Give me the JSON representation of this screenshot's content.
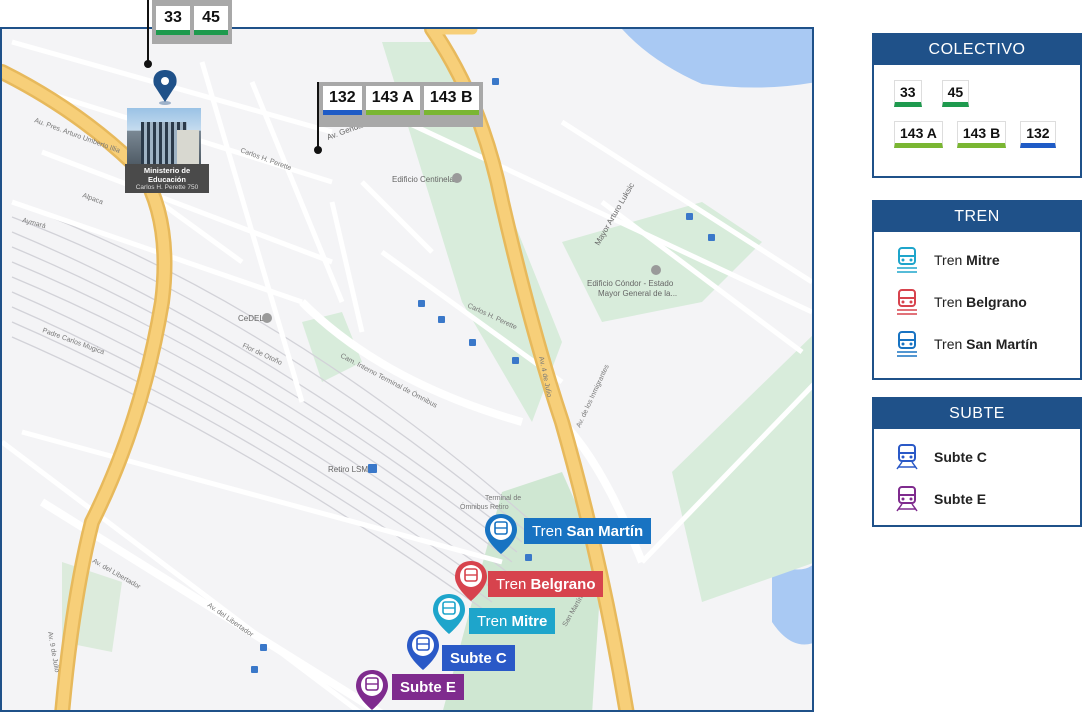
{
  "map": {
    "labels": {
      "gendarmeria": "Av. Gendarmería Nacional",
      "centinela": "Edificio Centinela",
      "condor_1": "Edificio Cóndor - Estado",
      "condor_2": "Mayor General de la...",
      "luksic": "Mayor Arturo Luksic",
      "perette_1": "Carlos H. Perette",
      "perette_2": "Carlos H. Perette",
      "alpaca": "Alpaca",
      "aymara": "Aymará",
      "cedel": "CeDEL",
      "flor_de_otono": "Flor de Otoño",
      "terminal_road": "Cam. Interno Terminal de Ómnibus",
      "retiro_lsm": "Retiro LSM",
      "terminal_1": "Terminal de",
      "terminal_2": "Ómnibus Retiro",
      "libertador_1": "Av. del Libertador",
      "libertador_2": "Av. del Libertador",
      "inmigrantes": "Av. de los Inmigrantes",
      "illia": "Au. Pres. Arturo Umberto Illia",
      "padre_mugica": "Padre Carlos Mugica",
      "julio": "Av. 9 de Julio",
      "san_martin_street": "San Martín",
      "cuatro_de_julio": "Av. 4 de Julio"
    },
    "ministry": {
      "name": "Ministerio de Educación",
      "address": "Carlos H. Perette 750"
    },
    "bus_callout_top": [
      "33",
      "45"
    ],
    "bus_callout_mid": [
      "132",
      "143 A",
      "143 B"
    ],
    "stations": {
      "san_martin": {
        "prefix": "Tren",
        "name": "San Martín",
        "color": "#1873c2"
      },
      "belgrano": {
        "prefix": "Tren",
        "name": "Belgrano",
        "color": "#d7434d"
      },
      "mitre": {
        "prefix": "Tren",
        "name": "Mitre",
        "color": "#1ea5cb"
      },
      "subte_c": {
        "prefix": "",
        "name": "Subte C",
        "color": "#2a59c7"
      },
      "subte_e": {
        "prefix": "",
        "name": "Subte E",
        "color": "#7f2b8e"
      }
    }
  },
  "legend": {
    "colectivo": {
      "title": "COLECTIVO",
      "row1": [
        "33",
        "45"
      ],
      "row2": [
        "143 A",
        "143 B",
        "132"
      ]
    },
    "tren": {
      "title": "TREN",
      "items": [
        {
          "prefix": "Tren",
          "name": "Mitre",
          "color": "#1ea5cb"
        },
        {
          "prefix": "Tren",
          "name": "Belgrano",
          "color": "#d7434d"
        },
        {
          "prefix": "Tren",
          "name": "San Martín",
          "color": "#1873c2"
        }
      ]
    },
    "subte": {
      "title": "SUBTE",
      "items": [
        {
          "name": "Subte C",
          "color": "#2a59c7"
        },
        {
          "name": "Subte E",
          "color": "#7f2b8e"
        }
      ]
    }
  }
}
